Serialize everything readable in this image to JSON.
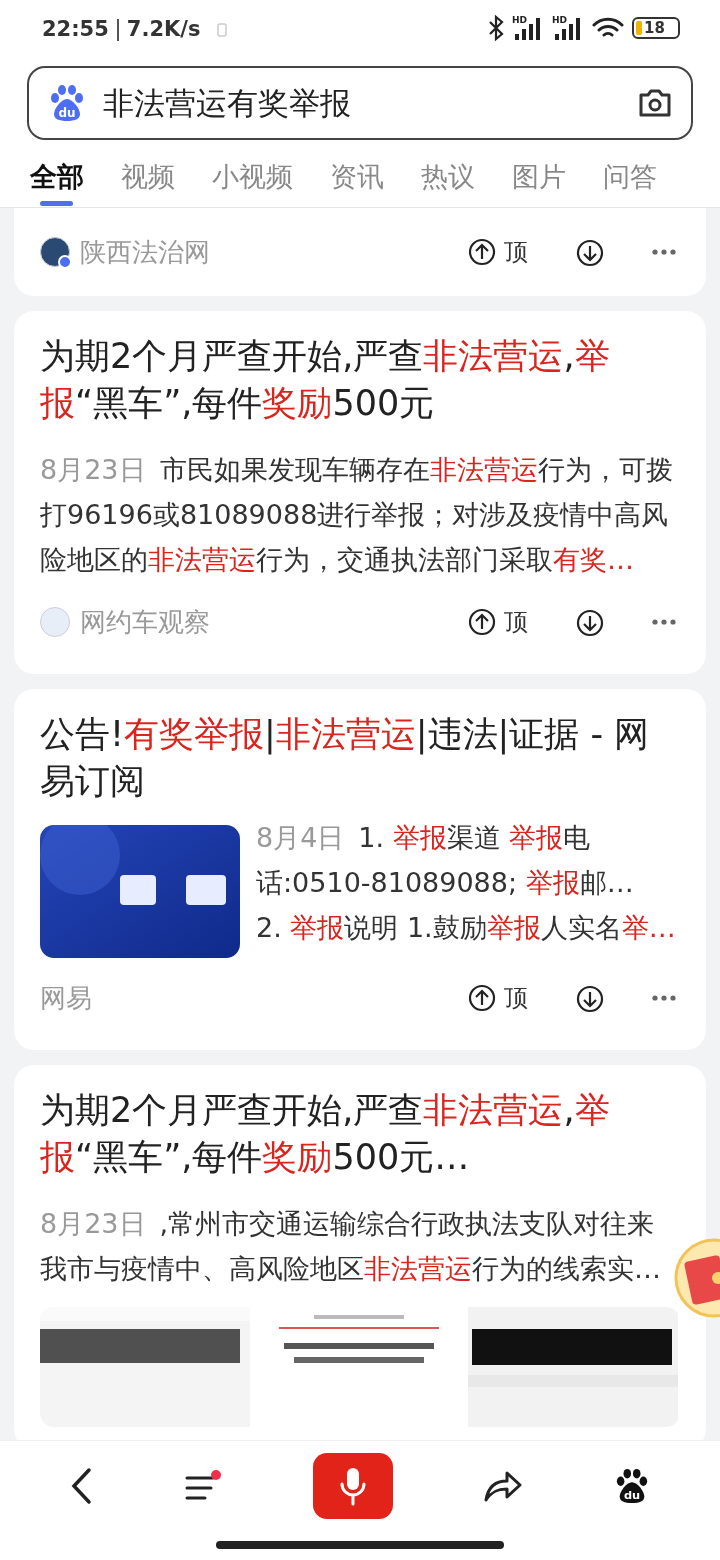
{
  "status_bar": {
    "time": "22:55",
    "speed": "7.2K/s",
    "signals": [
      {
        "label": "HD"
      },
      {
        "label": "HD"
      }
    ],
    "battery": "18"
  },
  "search": {
    "logo_text": "du",
    "query": "非法营运有奖举报"
  },
  "tabs": [
    {
      "label": "全部",
      "selected": true
    },
    {
      "label": "视频",
      "selected": false
    },
    {
      "label": "小视频",
      "selected": false
    },
    {
      "label": "资讯",
      "selected": false
    },
    {
      "label": "热议",
      "selected": false
    },
    {
      "label": "图片",
      "selected": false
    },
    {
      "label": "问答",
      "selected": false
    }
  ],
  "results": [
    {
      "kind": "footer_only",
      "source": "陕西法治网",
      "logo": true,
      "verified": true,
      "up_label": "顶"
    },
    {
      "kind": "text",
      "title": [
        {
          "text": "为期2个月严查开始,严查",
          "highlight": false
        },
        {
          "text": "非法营运",
          "highlight": true
        },
        {
          "text": ",",
          "highlight": false
        },
        {
          "text": "举报",
          "highlight": true
        },
        {
          "text": "“黑车”,每件",
          "highlight": false
        },
        {
          "text": "奖励",
          "highlight": true
        },
        {
          "text": "500元",
          "highlight": false
        }
      ],
      "paragraphs": [
        {
          "date": "8月23日",
          "segments": [
            {
              "text": "市民如果发现车辆存在",
              "highlight": false
            },
            {
              "text": "非法营运",
              "highlight": true
            },
            {
              "text": "行为，可拨打96196或81089088进行举报；对涉及疫情中高风险地区的",
              "highlight": false
            },
            {
              "text": "非法营运",
              "highlight": true
            },
            {
              "text": "行为，交通执法部门采取",
              "highlight": false
            },
            {
              "text": "有奖…",
              "highlight": true
            }
          ]
        }
      ],
      "source": "网约车观察",
      "logo": true,
      "verified": false,
      "up_label": "顶"
    },
    {
      "kind": "thumb",
      "title": [
        {
          "text": "公告!",
          "highlight": false
        },
        {
          "text": "有奖举报",
          "highlight": true
        },
        {
          "text": "|",
          "highlight": false
        },
        {
          "text": "非法营运",
          "highlight": true
        },
        {
          "text": "|违法|证据 - 网易订阅",
          "highlight": false
        }
      ],
      "paragraphs": [
        {
          "date": "8月4日",
          "segments": [
            {
              "text": "1. ",
              "highlight": false
            },
            {
              "text": "举报",
              "highlight": true
            },
            {
              "text": "渠道 ",
              "highlight": false
            },
            {
              "text": "举报",
              "highlight": true
            },
            {
              "text": "电话:0510-81089088; ",
              "highlight": false
            },
            {
              "text": "举报",
              "highlight": true
            },
            {
              "text": "邮…",
              "highlight": false
            }
          ]
        },
        {
          "segments": [
            {
              "text": "2. ",
              "highlight": false
            },
            {
              "text": "举报",
              "highlight": true
            },
            {
              "text": "说明 1.鼓励",
              "highlight": false
            },
            {
              "text": "举报",
              "highlight": true
            },
            {
              "text": "人实名",
              "highlight": false
            },
            {
              "text": "举…",
              "highlight": true
            }
          ]
        }
      ],
      "source": "网易",
      "logo": false,
      "up_label": "顶"
    },
    {
      "kind": "gallery",
      "title": [
        {
          "text": "为期2个月严查开始,严查",
          "highlight": false
        },
        {
          "text": "非法营运",
          "highlight": true
        },
        {
          "text": ",",
          "highlight": false
        },
        {
          "text": "举报",
          "highlight": true
        },
        {
          "text": "“黑车”,每件",
          "highlight": false
        },
        {
          "text": "奖励",
          "highlight": true
        },
        {
          "text": "500元…",
          "highlight": false
        }
      ],
      "paragraphs": [
        {
          "date": "8月23日",
          "segments": [
            {
              "text": ",常州市交通运输综合行政执法支队对往来我市与疫情中、高风险地区",
              "highlight": false
            },
            {
              "text": "非法营运",
              "highlight": true
            },
            {
              "text": "行为的线索实…",
              "highlight": false
            }
          ]
        }
      ],
      "images": [
        {
          "kind": "picture"
        },
        {
          "kind": "picture"
        },
        {
          "kind": "picture"
        }
      ]
    }
  ],
  "bottom_nav": {
    "menu_badge": true,
    "logo_text": "du"
  }
}
